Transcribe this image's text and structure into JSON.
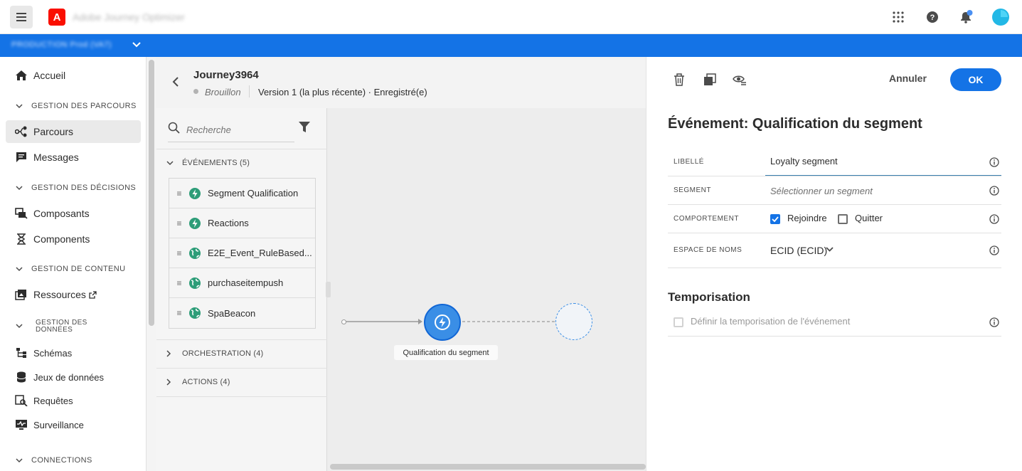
{
  "topbar": {
    "app_title": "Adobe Journey Optimizer",
    "logo_letter": "A"
  },
  "orgbar": {
    "org_name": "PRODUCTION  Prod (VA7)"
  },
  "nav": {
    "home": "Accueil",
    "section_journeys": "GESTION DES PARCOURS",
    "journeys": "Parcours",
    "messages": "Messages",
    "section_decisions": "GESTION DES DÉCISIONS",
    "composants": "Composants",
    "components": "Components",
    "section_content": "GESTION DE CONTENU",
    "resources": "Ressources",
    "section_data_line1": "GESTION DES",
    "section_data_line2": "DONNÉES",
    "schemas": "Schémas",
    "datasets": "Jeux de données",
    "queries": "Requêtes",
    "monitoring": "Surveillance",
    "section_connections": "CONNECTIONS"
  },
  "journey": {
    "name": "Journey3964",
    "status": "Brouillon",
    "version": "Version 1 (la plus récente) · Enregistré(e)"
  },
  "palette": {
    "search_placeholder": "Recherche",
    "events_header": "ÉVÉNEMENTS (5)",
    "events": [
      {
        "label": "Segment Qualification",
        "icon": "lightning-icon"
      },
      {
        "label": "Reactions",
        "icon": "lightning-icon"
      },
      {
        "label": "E2E_Event_RuleBased...",
        "icon": "globe-icon"
      },
      {
        "label": "purchaseitempush",
        "icon": "globe-icon"
      },
      {
        "label": "SpaBeacon",
        "icon": "globe-icon"
      }
    ],
    "orchestration_header": "ORCHESTRATION (4)",
    "actions_header": "ACTIONS (4)"
  },
  "canvas": {
    "node_label": "Qualification du segment"
  },
  "panel": {
    "cancel": "Annuler",
    "ok": "OK",
    "title": "Événement: Qualification du segment",
    "libelle_label": "LIBELLÉ",
    "libelle_value": "Loyalty segment",
    "segment_label": "SEGMENT",
    "segment_placeholder": "Sélectionner un segment",
    "behavior_label": "COMPORTEMENT",
    "join_label": "Rejoindre",
    "leave_label": "Quitter",
    "namespace_label": "ESPACE DE NOMS",
    "namespace_value": "ECID (ECID)",
    "timing_title": "Temporisation",
    "timing_checkbox": "Définir la temporisation de l'événement"
  },
  "colors": {
    "accent": "#1473e6",
    "event_green": "#2d9d78",
    "adobe_red": "#fa0f00"
  }
}
